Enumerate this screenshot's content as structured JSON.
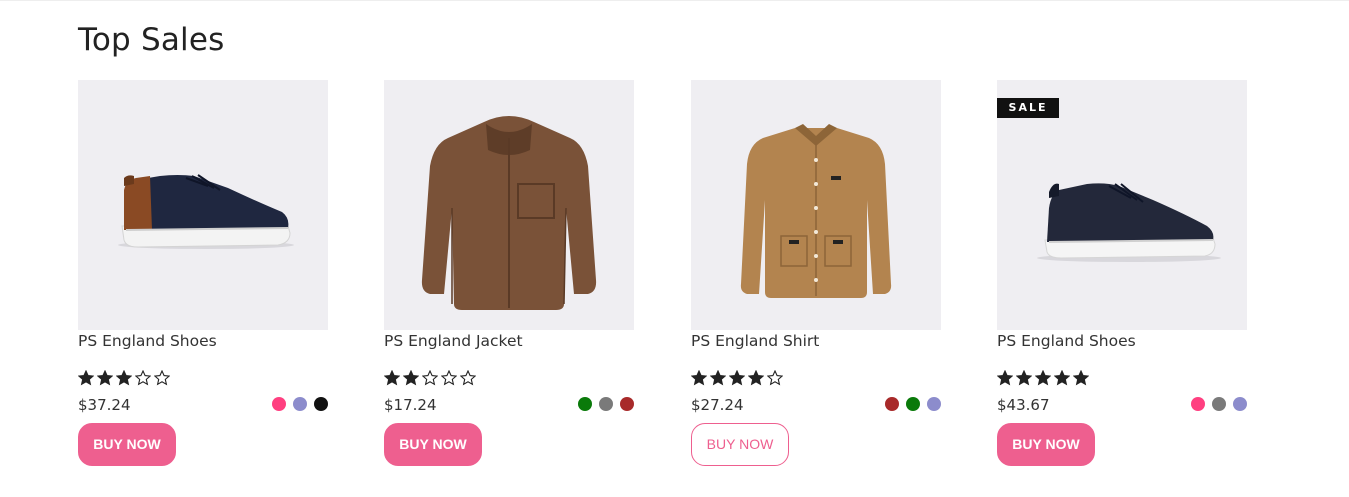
{
  "section": {
    "title": "Top Sales"
  },
  "theme": {
    "accent": "#ee5f8f",
    "star": "#222222"
  },
  "products": [
    {
      "name": "PS England Shoes",
      "price": "$37.24",
      "rating": 3,
      "max_rating": 5,
      "swatches": [
        "#ff3f80",
        "#8c8ccc",
        "#111111"
      ],
      "badge": "",
      "button": "BUY NOW",
      "button_style": "filled"
    },
    {
      "name": "PS England Jacket",
      "price": "$17.24",
      "rating": 2,
      "max_rating": 5,
      "swatches": [
        "#0a7a0a",
        "#7a7a7a",
        "#a82a2a"
      ],
      "badge": "",
      "button": "BUY NOW",
      "button_style": "filled"
    },
    {
      "name": "PS England Shirt",
      "price": "$27.24",
      "rating": 4,
      "max_rating": 5,
      "swatches": [
        "#a82a2a",
        "#0a7a0a",
        "#8c8ccc"
      ],
      "badge": "",
      "button": "BUY NOW",
      "button_style": "outline"
    },
    {
      "name": "PS England Shoes",
      "price": "$43.67",
      "rating": 5,
      "max_rating": 5,
      "swatches": [
        "#ff3f80",
        "#7a7a7a",
        "#8c8ccc"
      ],
      "badge": "SALE",
      "button": "BUY NOW",
      "button_style": "filled"
    }
  ]
}
